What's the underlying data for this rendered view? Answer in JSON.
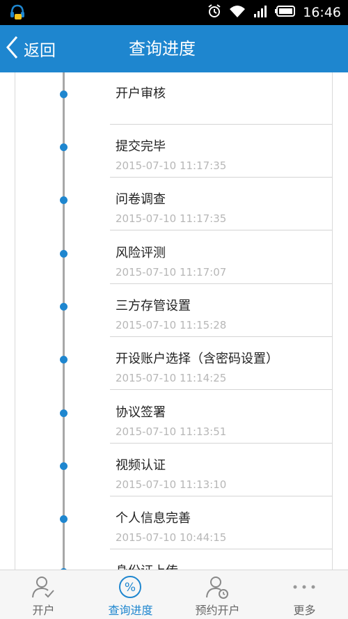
{
  "status_bar": {
    "time": "16:46"
  },
  "header": {
    "back_label": "返回",
    "title": "查询进度"
  },
  "steps": [
    {
      "title": "开户审核",
      "time": ""
    },
    {
      "title": "提交完毕",
      "time": "2015-07-10 11:17:35"
    },
    {
      "title": "问卷调查",
      "time": "2015-07-10 11:17:35"
    },
    {
      "title": "风险评测",
      "time": "2015-07-10 11:17:07"
    },
    {
      "title": "三方存管设置",
      "time": "2015-07-10 11:15:28"
    },
    {
      "title": "开设账户选择（含密码设置）",
      "time": "2015-07-10 11:14:25"
    },
    {
      "title": "协议签署",
      "time": "2015-07-10 11:13:51"
    },
    {
      "title": "视频认证",
      "time": "2015-07-10 11:13:10"
    },
    {
      "title": "个人信息完善",
      "time": "2015-07-10 10:44:15"
    },
    {
      "title": "身份证上传",
      "time": ""
    }
  ],
  "tabs": [
    {
      "label": "开户",
      "icon": "user-check-icon"
    },
    {
      "label": "查询进度",
      "icon": "percent-icon",
      "active": true
    },
    {
      "label": "预约开户",
      "icon": "user-clock-icon"
    },
    {
      "label": "更多",
      "icon": "more-icon"
    }
  ],
  "colors": {
    "accent": "#1e86cf",
    "timeline": "#a7a7a7",
    "timestamp": "#b7b7b7"
  }
}
